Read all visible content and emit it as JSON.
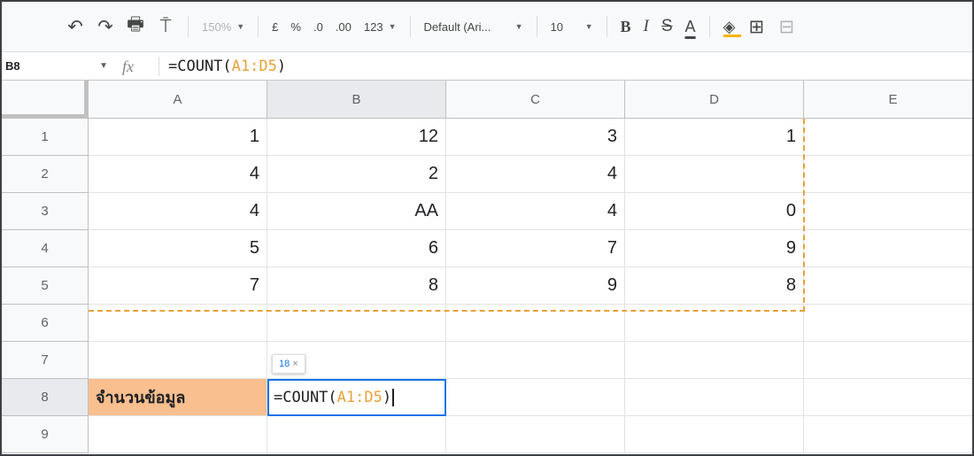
{
  "toolbar": {
    "undo_icon": "undo-icon",
    "redo_icon": "redo-icon",
    "print_icon": "print-icon",
    "paint_format_icon": "paint-format-icon",
    "zoom": "150%",
    "currency": "£",
    "percent": "%",
    "decrease_decimal": ".0",
    "increase_decimal": ".00",
    "more_formats": "123",
    "font": "Default (Ari...",
    "font_size": "10",
    "bold": "B",
    "italic": "I",
    "strikethrough": "S",
    "text_color": "A",
    "fill_color_icon": "fill-color-icon",
    "borders_icon": "borders-icon",
    "merge_icon": "merge-cells-icon"
  },
  "formula_bar": {
    "name_box": "B8",
    "fx": "fx",
    "formula_prefix": "=COUNT(",
    "formula_range": "A1:D5",
    "formula_suffix": ")"
  },
  "columns": [
    "A",
    "B",
    "C",
    "D",
    "E"
  ],
  "rows": [
    {
      "num": "1",
      "cells": [
        "1",
        "12",
        "3",
        "1",
        ""
      ]
    },
    {
      "num": "2",
      "cells": [
        "4",
        "2",
        "4",
        "",
        ""
      ]
    },
    {
      "num": "3",
      "cells": [
        "4",
        "AA",
        "4",
        "0",
        ""
      ]
    },
    {
      "num": "4",
      "cells": [
        "5",
        "6",
        "7",
        "9",
        ""
      ]
    },
    {
      "num": "5",
      "cells": [
        "7",
        "8",
        "9",
        "8",
        ""
      ]
    },
    {
      "num": "6",
      "cells": [
        "",
        "",
        "",
        "",
        ""
      ]
    },
    {
      "num": "7",
      "cells": [
        "",
        "",
        "",
        "",
        ""
      ]
    },
    {
      "num": "8",
      "cells": [
        "จำนวนข้อมูล",
        "=COUNT(A1:D5)",
        "",
        "",
        ""
      ]
    },
    {
      "num": "9",
      "cells": [
        "",
        "",
        "",
        "",
        ""
      ]
    }
  ],
  "selected_cell": "B8",
  "tooltip": {
    "value": "18",
    "close": "×"
  },
  "colors": {
    "range_highlight": "#e6a23c",
    "label_fill": "#f9bf8f",
    "active_border": "#1a73e8"
  }
}
